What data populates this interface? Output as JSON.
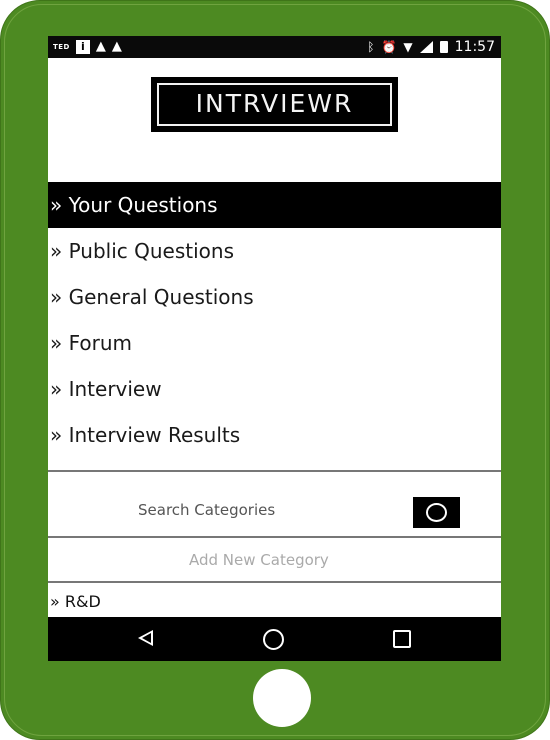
{
  "status_bar": {
    "carrier_label": "TED",
    "info_icon": "i",
    "time": "11:57",
    "icons": [
      "ted-icon",
      "info-icon",
      "warning-icon",
      "warning-icon",
      "bluetooth-icon",
      "alarm-icon",
      "wifi-icon",
      "signal-icon",
      "battery-icon"
    ]
  },
  "logo": {
    "text": "INTRVIEWR"
  },
  "menu": {
    "items": [
      {
        "label": "» Your Questions",
        "active": true
      },
      {
        "label": "» Public Questions",
        "active": false
      },
      {
        "label": "» General Questions",
        "active": false
      },
      {
        "label": "» Forum",
        "active": false
      },
      {
        "label": "» Interview",
        "active": false
      },
      {
        "label": "» Interview Results",
        "active": false
      }
    ]
  },
  "categories": {
    "search_placeholder": "Search Categories",
    "search_button_icon": "search-circle-icon",
    "add_placeholder": "Add New Category",
    "items": [
      {
        "label": "» R&D"
      }
    ]
  },
  "nav_bar": {
    "icons": [
      "back-icon",
      "home-icon",
      "recents-icon"
    ]
  },
  "colors": {
    "device_green": "#4d8a22",
    "active_item_bg": "#000000"
  }
}
